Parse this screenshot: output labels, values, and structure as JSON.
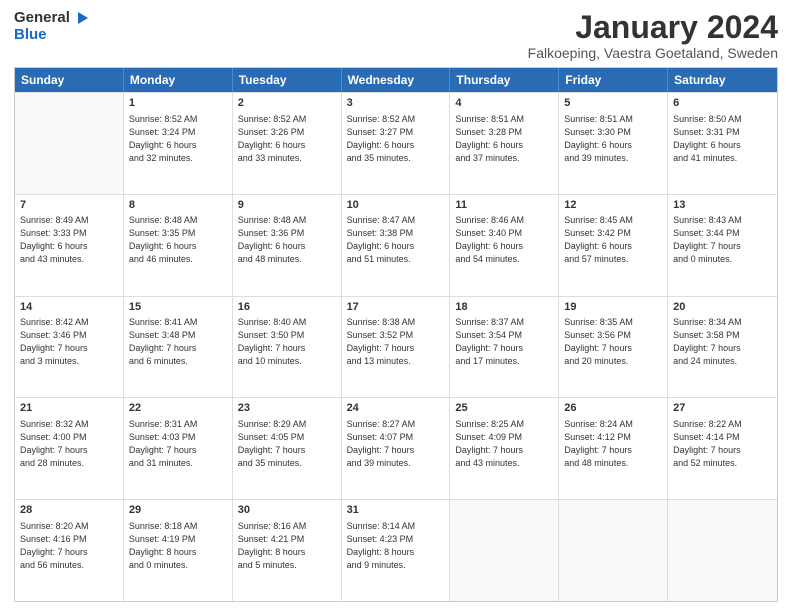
{
  "header": {
    "logo_line1": "General",
    "logo_line2": "Blue",
    "month_title": "January 2024",
    "subtitle": "Falkoeping, Vaestra Goetaland, Sweden"
  },
  "days_of_week": [
    "Sunday",
    "Monday",
    "Tuesday",
    "Wednesday",
    "Thursday",
    "Friday",
    "Saturday"
  ],
  "weeks": [
    [
      {
        "day": "",
        "lines": []
      },
      {
        "day": "1",
        "lines": [
          "Sunrise: 8:52 AM",
          "Sunset: 3:24 PM",
          "Daylight: 6 hours",
          "and 32 minutes."
        ]
      },
      {
        "day": "2",
        "lines": [
          "Sunrise: 8:52 AM",
          "Sunset: 3:26 PM",
          "Daylight: 6 hours",
          "and 33 minutes."
        ]
      },
      {
        "day": "3",
        "lines": [
          "Sunrise: 8:52 AM",
          "Sunset: 3:27 PM",
          "Daylight: 6 hours",
          "and 35 minutes."
        ]
      },
      {
        "day": "4",
        "lines": [
          "Sunrise: 8:51 AM",
          "Sunset: 3:28 PM",
          "Daylight: 6 hours",
          "and 37 minutes."
        ]
      },
      {
        "day": "5",
        "lines": [
          "Sunrise: 8:51 AM",
          "Sunset: 3:30 PM",
          "Daylight: 6 hours",
          "and 39 minutes."
        ]
      },
      {
        "day": "6",
        "lines": [
          "Sunrise: 8:50 AM",
          "Sunset: 3:31 PM",
          "Daylight: 6 hours",
          "and 41 minutes."
        ]
      }
    ],
    [
      {
        "day": "7",
        "lines": [
          "Sunrise: 8:49 AM",
          "Sunset: 3:33 PM",
          "Daylight: 6 hours",
          "and 43 minutes."
        ]
      },
      {
        "day": "8",
        "lines": [
          "Sunrise: 8:48 AM",
          "Sunset: 3:35 PM",
          "Daylight: 6 hours",
          "and 46 minutes."
        ]
      },
      {
        "day": "9",
        "lines": [
          "Sunrise: 8:48 AM",
          "Sunset: 3:36 PM",
          "Daylight: 6 hours",
          "and 48 minutes."
        ]
      },
      {
        "day": "10",
        "lines": [
          "Sunrise: 8:47 AM",
          "Sunset: 3:38 PM",
          "Daylight: 6 hours",
          "and 51 minutes."
        ]
      },
      {
        "day": "11",
        "lines": [
          "Sunrise: 8:46 AM",
          "Sunset: 3:40 PM",
          "Daylight: 6 hours",
          "and 54 minutes."
        ]
      },
      {
        "day": "12",
        "lines": [
          "Sunrise: 8:45 AM",
          "Sunset: 3:42 PM",
          "Daylight: 6 hours",
          "and 57 minutes."
        ]
      },
      {
        "day": "13",
        "lines": [
          "Sunrise: 8:43 AM",
          "Sunset: 3:44 PM",
          "Daylight: 7 hours",
          "and 0 minutes."
        ]
      }
    ],
    [
      {
        "day": "14",
        "lines": [
          "Sunrise: 8:42 AM",
          "Sunset: 3:46 PM",
          "Daylight: 7 hours",
          "and 3 minutes."
        ]
      },
      {
        "day": "15",
        "lines": [
          "Sunrise: 8:41 AM",
          "Sunset: 3:48 PM",
          "Daylight: 7 hours",
          "and 6 minutes."
        ]
      },
      {
        "day": "16",
        "lines": [
          "Sunrise: 8:40 AM",
          "Sunset: 3:50 PM",
          "Daylight: 7 hours",
          "and 10 minutes."
        ]
      },
      {
        "day": "17",
        "lines": [
          "Sunrise: 8:38 AM",
          "Sunset: 3:52 PM",
          "Daylight: 7 hours",
          "and 13 minutes."
        ]
      },
      {
        "day": "18",
        "lines": [
          "Sunrise: 8:37 AM",
          "Sunset: 3:54 PM",
          "Daylight: 7 hours",
          "and 17 minutes."
        ]
      },
      {
        "day": "19",
        "lines": [
          "Sunrise: 8:35 AM",
          "Sunset: 3:56 PM",
          "Daylight: 7 hours",
          "and 20 minutes."
        ]
      },
      {
        "day": "20",
        "lines": [
          "Sunrise: 8:34 AM",
          "Sunset: 3:58 PM",
          "Daylight: 7 hours",
          "and 24 minutes."
        ]
      }
    ],
    [
      {
        "day": "21",
        "lines": [
          "Sunrise: 8:32 AM",
          "Sunset: 4:00 PM",
          "Daylight: 7 hours",
          "and 28 minutes."
        ]
      },
      {
        "day": "22",
        "lines": [
          "Sunrise: 8:31 AM",
          "Sunset: 4:03 PM",
          "Daylight: 7 hours",
          "and 31 minutes."
        ]
      },
      {
        "day": "23",
        "lines": [
          "Sunrise: 8:29 AM",
          "Sunset: 4:05 PM",
          "Daylight: 7 hours",
          "and 35 minutes."
        ]
      },
      {
        "day": "24",
        "lines": [
          "Sunrise: 8:27 AM",
          "Sunset: 4:07 PM",
          "Daylight: 7 hours",
          "and 39 minutes."
        ]
      },
      {
        "day": "25",
        "lines": [
          "Sunrise: 8:25 AM",
          "Sunset: 4:09 PM",
          "Daylight: 7 hours",
          "and 43 minutes."
        ]
      },
      {
        "day": "26",
        "lines": [
          "Sunrise: 8:24 AM",
          "Sunset: 4:12 PM",
          "Daylight: 7 hours",
          "and 48 minutes."
        ]
      },
      {
        "day": "27",
        "lines": [
          "Sunrise: 8:22 AM",
          "Sunset: 4:14 PM",
          "Daylight: 7 hours",
          "and 52 minutes."
        ]
      }
    ],
    [
      {
        "day": "28",
        "lines": [
          "Sunrise: 8:20 AM",
          "Sunset: 4:16 PM",
          "Daylight: 7 hours",
          "and 56 minutes."
        ]
      },
      {
        "day": "29",
        "lines": [
          "Sunrise: 8:18 AM",
          "Sunset: 4:19 PM",
          "Daylight: 8 hours",
          "and 0 minutes."
        ]
      },
      {
        "day": "30",
        "lines": [
          "Sunrise: 8:16 AM",
          "Sunset: 4:21 PM",
          "Daylight: 8 hours",
          "and 5 minutes."
        ]
      },
      {
        "day": "31",
        "lines": [
          "Sunrise: 8:14 AM",
          "Sunset: 4:23 PM",
          "Daylight: 8 hours",
          "and 9 minutes."
        ]
      },
      {
        "day": "",
        "lines": []
      },
      {
        "day": "",
        "lines": []
      },
      {
        "day": "",
        "lines": []
      }
    ]
  ]
}
